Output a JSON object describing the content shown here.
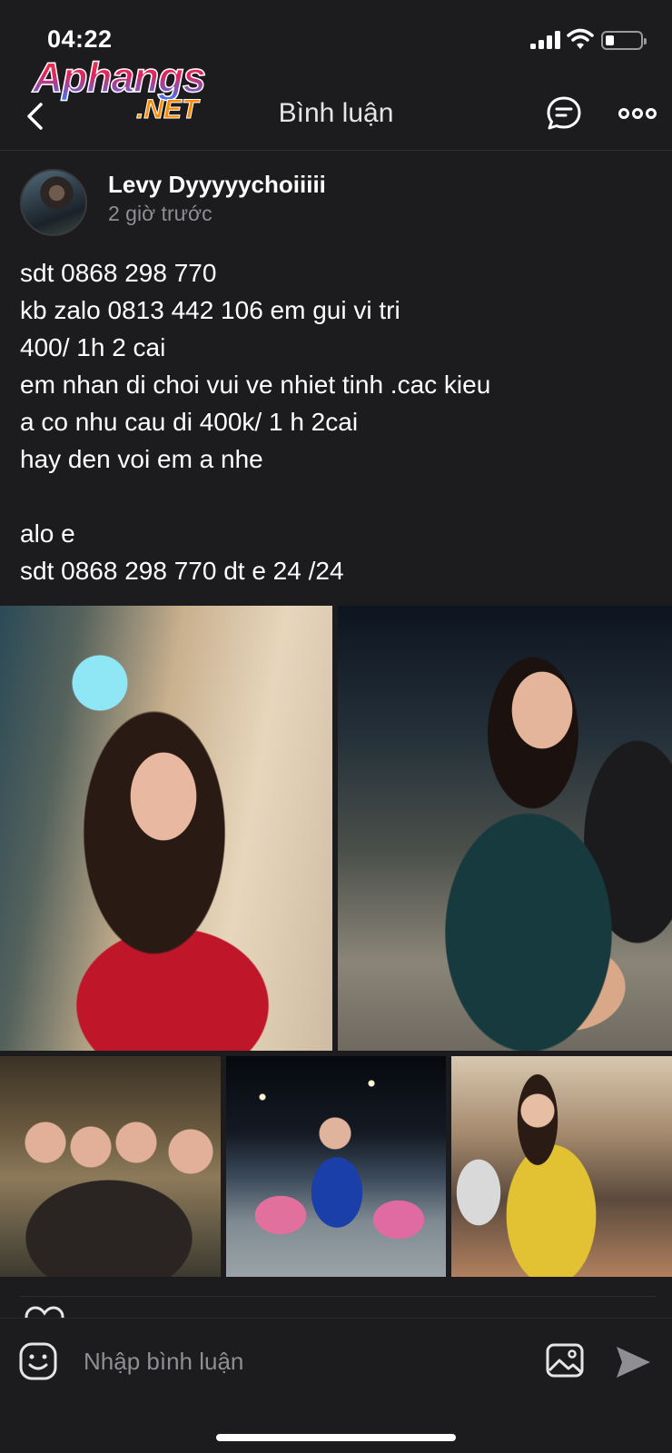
{
  "status_bar": {
    "time": "04:22",
    "icons": [
      "signal-icon",
      "wifi-icon",
      "battery-icon"
    ]
  },
  "watermark": {
    "main": "Aphangs",
    "sub": ".NET"
  },
  "nav": {
    "title": "Bình luận",
    "icons": [
      "back-chevron-icon",
      "chat-icon",
      "more-icon"
    ]
  },
  "post": {
    "author": "Levy Dyyyyychoiiiii",
    "time": "2 giờ trước",
    "lines": [
      "sdt 0868 298 770",
      "kb zalo 0813 442 106 em gui vi tri",
      "400/ 1h 2 cai",
      "em nhan di choi vui ve nhiet tinh .cac kieu",
      "a co nhu cau di 400k/ 1 h 2cai",
      "hay den voi em a nhe",
      "",
      "alo e",
      "sdt 0868 298 770 dt e 24 /24"
    ],
    "photo_count": 5
  },
  "composer": {
    "placeholder": "Nhập bình luận",
    "value": "",
    "icons": [
      "emoji-icon",
      "image-icon",
      "send-icon"
    ]
  },
  "colors": {
    "background": "#1c1c1e",
    "text": "#ffffff",
    "secondary_text": "#8e8e93",
    "divider": "#2e2e30",
    "send_disabled": "#8e8e93"
  }
}
